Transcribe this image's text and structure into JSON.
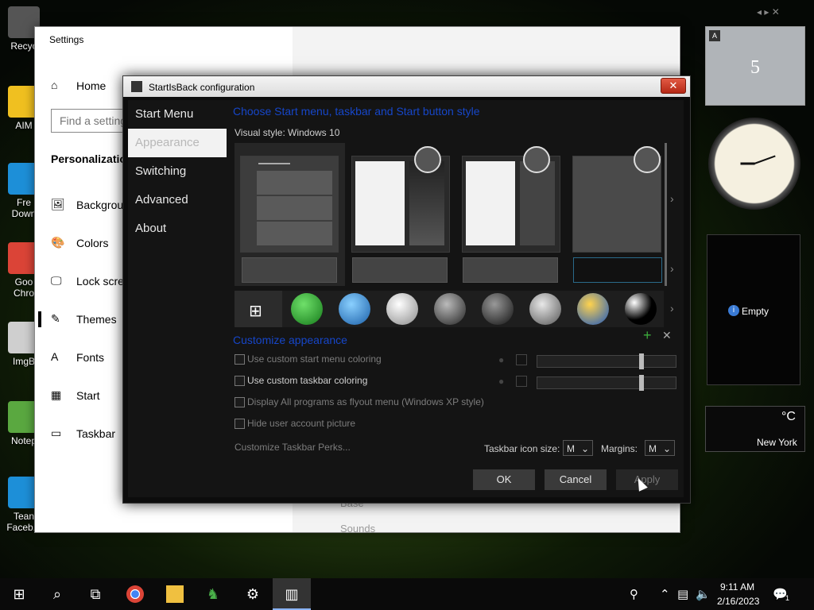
{
  "desktop": {
    "icons": [
      {
        "label": "Recyc",
        "color": "#555555"
      },
      {
        "label": "AIM",
        "color": "#f0c020"
      },
      {
        "label": "Fre\nDown",
        "color": "#1d8fd8"
      },
      {
        "label": "Goo\nChro",
        "color": "#db4437"
      },
      {
        "label": "ImgB",
        "color": "#cfcfcf"
      },
      {
        "label": "Notep",
        "color": "#5aa840"
      },
      {
        "label": "Tean\nFaceb...",
        "color": "#1d8fd8"
      }
    ]
  },
  "settings": {
    "title": "Settings",
    "minimize": "—",
    "maximize": "☐",
    "close": "✕",
    "home": "Home",
    "search_placeholder": "Find a setting",
    "section": "Personalization",
    "nav": [
      {
        "label": "Background",
        "icon": "🖼"
      },
      {
        "label": "Colors",
        "icon": "🎨"
      },
      {
        "label": "Lock screen",
        "icon": "🖵"
      },
      {
        "label": "Themes",
        "icon": "✎"
      },
      {
        "label": "Fonts",
        "icon": "A"
      },
      {
        "label": "Start",
        "icon": "▦"
      },
      {
        "label": "Taskbar",
        "icon": "▭"
      }
    ],
    "faded_items": [
      "Base",
      "Sounds"
    ]
  },
  "sib": {
    "title": "StartIsBack configuration",
    "close": "✕",
    "nav": [
      {
        "label": "Start Menu",
        "selected": false
      },
      {
        "label": "Appearance",
        "selected": true
      },
      {
        "label": "Switching",
        "selected": false
      },
      {
        "label": "Advanced",
        "selected": false
      },
      {
        "label": "About",
        "selected": false
      }
    ],
    "heading_style": "Choose Start menu, taskbar and Start button style",
    "visual_style_label": "Visual style:",
    "visual_style_value": "Windows 10",
    "heading_custom": "Customize appearance",
    "options": [
      {
        "label": "Use custom start menu coloring",
        "enabled": false
      },
      {
        "label": "Use custom taskbar coloring",
        "enabled": true
      },
      {
        "label": "Display All programs as flyout menu (Windows XP style)",
        "enabled": false
      },
      {
        "label": "Hide user account picture",
        "enabled": false
      }
    ],
    "perks_link": "Customize Taskbar Perks...",
    "icon_size_label": "Taskbar icon size:",
    "icon_size_value": "M",
    "margins_label": "Margins:",
    "margins_value": "M",
    "ok": "OK",
    "cancel": "Cancel",
    "apply": "Apply",
    "add_icon": "+",
    "remove_icon": "✕"
  },
  "gadgets": {
    "calendar_day": "5",
    "calendar_badge": "A",
    "slideshow_empty": "Empty",
    "weather_unit": "°C",
    "weather_city": "New York"
  },
  "taskbar": {
    "time": "9:11 AM",
    "date": "2/16/2023",
    "notification_count": "1"
  }
}
